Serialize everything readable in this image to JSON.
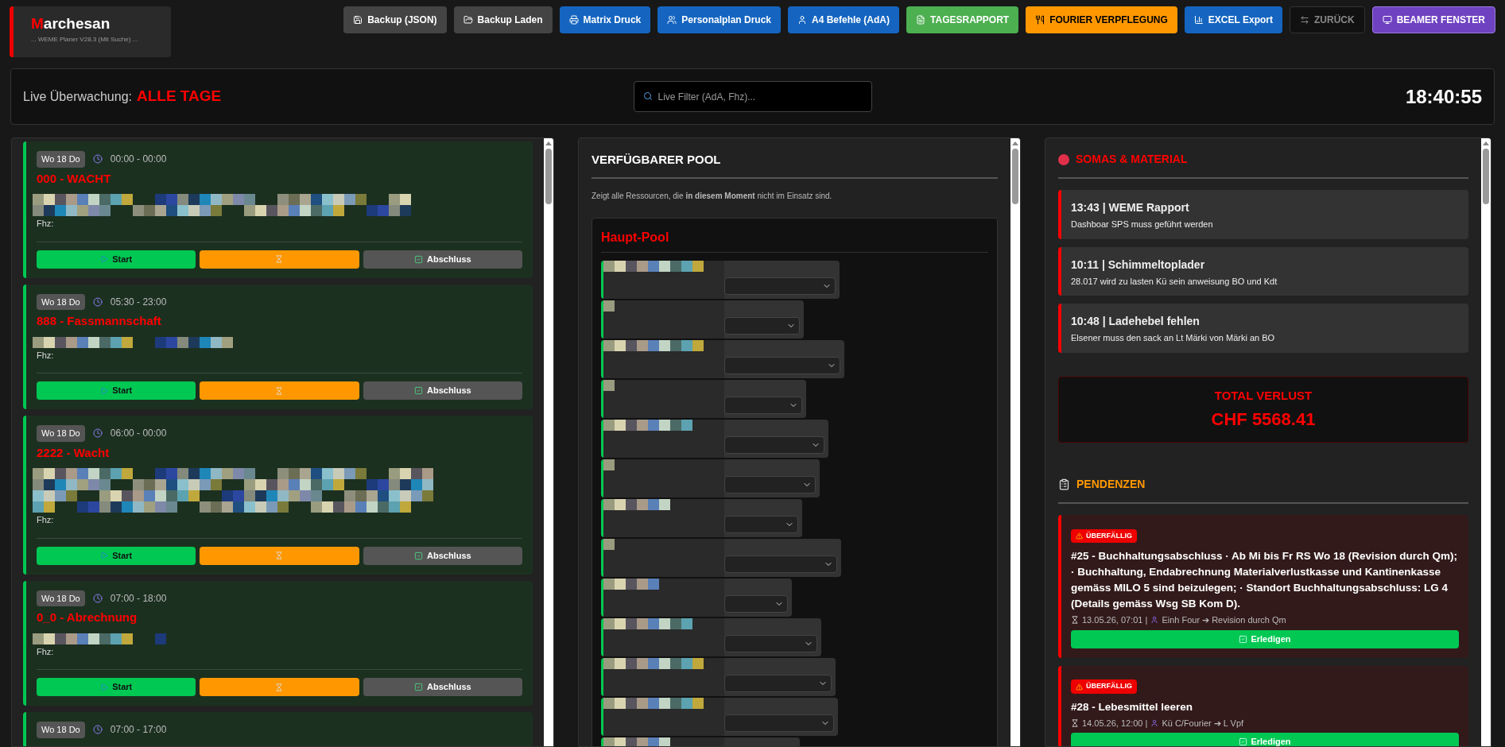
{
  "app": {
    "logo_initial": "M",
    "logo_rest": "archesan",
    "subtitle": "... WEME Planer V28.3 (Mit Suche) ..."
  },
  "toolbar": [
    {
      "label": "Backup (JSON)",
      "kind": "neutral"
    },
    {
      "label": "Backup Laden",
      "kind": "neutral"
    },
    {
      "label": "Matrix Druck",
      "kind": "primary"
    },
    {
      "label": "Personalplan Druck",
      "kind": "primary"
    },
    {
      "label": "A4 Befehle (AdA)",
      "kind": "primary"
    },
    {
      "label": "TAGESRAPPORT",
      "kind": "success"
    },
    {
      "label": "FOURIER VERPFLEGUNG",
      "kind": "warning"
    },
    {
      "label": "EXCEL Export",
      "kind": "primary"
    },
    {
      "label": "ZURÜCK",
      "kind": "ghost"
    },
    {
      "label": "BEAMER FENSTER",
      "kind": "accent"
    }
  ],
  "live_bar": {
    "label": "Live Überwachung:",
    "value": "ALLE TAGE",
    "search": {
      "placeholder": "Live Filter (AdA, Fhz)..."
    },
    "clock": "18:40:55"
  },
  "missions": [
    {
      "day": "Wo 18 Do",
      "time": "00:00 - 00:00",
      "title": "000 - WACHT",
      "vehicle_label": "Fhz:",
      "start_label": "Start",
      "finish_label": "Abschluss"
    },
    {
      "day": "Wo 18 Do",
      "time": "05:30 - 23:00",
      "title": "888 - Fassmannschaft",
      "vehicle_label": "Fhz:",
      "start_label": "Start",
      "finish_label": "Abschluss"
    },
    {
      "day": "Wo 18 Do",
      "time": "06:00 - 00:00",
      "title": "2222 - Wacht",
      "vehicle_label": "Fhz:",
      "start_label": "Start",
      "finish_label": "Abschluss"
    },
    {
      "day": "Wo 18 Do",
      "time": "07:00 - 18:00",
      "title": "0_0 - Abrechnung",
      "vehicle_label": "Fhz:",
      "start_label": "Start",
      "finish_label": "Abschluss"
    },
    {
      "day": "Wo 18 Do",
      "time": "07:00 - 17:00"
    }
  ],
  "pool": {
    "title": "VERFÜGBARER POOL",
    "note": "Zeigt alle Ressourcen, die **in diesem Moment** nicht im Einsatz sind.",
    "group": "Haupt-Pool",
    "rows": [
      {
        "kind": "resource"
      },
      {
        "kind": "resource"
      },
      {
        "kind": "resource"
      },
      {
        "kind": "resource"
      },
      {
        "kind": "resource"
      },
      {
        "kind": "resource"
      },
      {
        "kind": "resource"
      },
      {
        "kind": "resource"
      },
      {
        "kind": "resource"
      },
      {
        "kind": "resource"
      },
      {
        "kind": "resource"
      },
      {
        "kind": "resource"
      },
      {
        "kind": "resource"
      }
    ]
  },
  "somas": {
    "title": "SOMAS & MATERIAL",
    "items": [
      {
        "heading": "13:43 | WEME Rapport",
        "text": "Dashboar SPS muss geführt werden"
      },
      {
        "heading": "10:11 | Schimmeltoplader",
        "text": "28.017 wird zu lasten Kü sein anweisung BO und Kdt"
      },
      {
        "heading": "10:48 | Ladehebel fehlen",
        "text": "Elsener muss den sack an Lt Märki von Märki an BO"
      }
    ],
    "total": {
      "label": "TOTAL VERLUST",
      "value": "CHF 5568.41"
    }
  },
  "pendenzen": {
    "title": "PENDENZEN",
    "items": [
      {
        "badge": "ÜBERFÄLLIG",
        "title": "#25 - Buchhaltungsabschluss · Ab Mi bis Fr RS Wo 18 (Revision durch Qm); · Buchhaltung, Endabrechnung Materialverlustkasse und Kantinenkasse gemäss MILO 5 sind beizulegen; · Standort Buchhaltungsabschluss: LG 4 (Details gemäss Wsg SB Kom D).",
        "due": "13.05.26, 07:01 |",
        "route": "Einh Four ➔ Revision durch Qm",
        "button": "Erledigen"
      },
      {
        "badge": "ÜBERFÄLLIG",
        "title": "#28 - Lebesmittel leeren",
        "due": "14.05.26, 12:00 |",
        "route": "Kü C/Fourier ➔ L Vpf",
        "button": "Erledigen"
      }
    ]
  }
}
